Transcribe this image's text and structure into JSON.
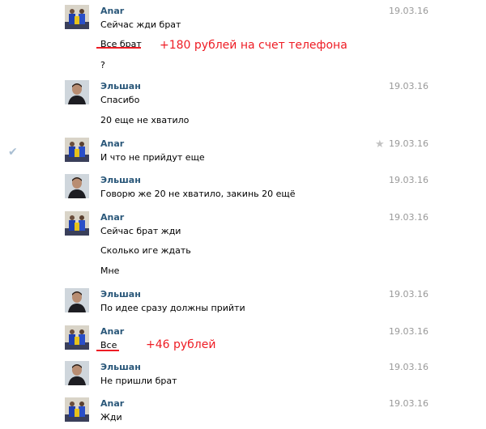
{
  "messages": [
    {
      "author": "Anar",
      "date": "19.03.16",
      "avatar": "anar",
      "lines": [
        "Сейчас жди брат",
        "Все брат",
        "?"
      ]
    },
    {
      "author": "Эльшан",
      "date": "19.03.16",
      "avatar": "elshan",
      "lines": [
        "Спасибо",
        "20 еще не хватило"
      ]
    },
    {
      "author": "Anar",
      "date": "19.03.16",
      "avatar": "anar",
      "lines": [
        "И что не прийдут еще"
      ]
    },
    {
      "author": "Эльшан",
      "date": "19.03.16",
      "avatar": "elshan",
      "lines": [
        "Говорю же 20 не хватило, закинь 20 ещё"
      ]
    },
    {
      "author": "Anar",
      "date": "19.03.16",
      "avatar": "anar",
      "lines": [
        "Сейчас брат жди",
        "Сколько иге ждать",
        "Мне"
      ]
    },
    {
      "author": "Эльшан",
      "date": "19.03.16",
      "avatar": "elshan",
      "lines": [
        "По идее сразу должны прийти"
      ]
    },
    {
      "author": "Anar",
      "date": "19.03.16",
      "avatar": "anar",
      "lines": [
        "Все"
      ]
    },
    {
      "author": "Эльшан",
      "date": "19.03.16",
      "avatar": "elshan",
      "lines": [
        "Не пришли брат"
      ]
    },
    {
      "author": "Anar",
      "date": "19.03.16",
      "avatar": "anar",
      "lines": [
        "Жди"
      ]
    }
  ],
  "annotations": {
    "note1": "+180 рублей на счет телефона",
    "note2": "+46 рублей",
    "color": "#ee1c24"
  },
  "icons": {
    "read_check": "checkmark-icon",
    "favorite": "star-icon"
  },
  "colors": {
    "author": "#2b587a",
    "date": "#999999",
    "text": "#000000"
  }
}
